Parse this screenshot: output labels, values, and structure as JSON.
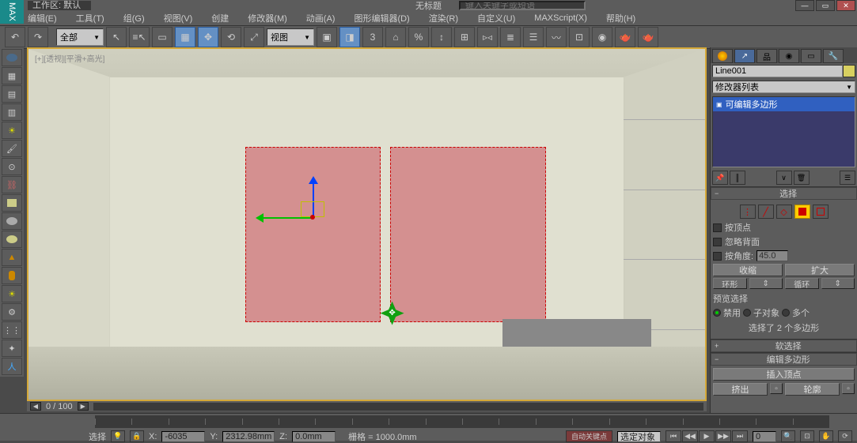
{
  "app": {
    "name": "MAX",
    "workspace_label": "工作区: 默认",
    "doc_title": "无标题",
    "search_placeholder": "键入关键字或短语"
  },
  "menus": [
    "编辑(E)",
    "工具(T)",
    "组(G)",
    "视图(V)",
    "创建",
    "修改器(M)",
    "动画(A)",
    "图形编辑器(D)",
    "渲染(R)",
    "自定义(U)",
    "MAXScript(X)",
    "帮助(H)"
  ],
  "toolbar": {
    "selection_filter": "全部",
    "refcoord": "视图"
  },
  "viewport": {
    "label": "[+][透视][平滑+高光]",
    "mini_axes": [
      "x",
      "y",
      "z"
    ],
    "scroll_label": "0 / 100"
  },
  "cmd": {
    "object_name": "Line001",
    "modlist_label": "修改器列表",
    "modifier": "可编辑多边形",
    "rollouts": {
      "selection": {
        "title": "选择",
        "by_vertex": "按顶点",
        "ignore_backfacing": "忽略背面",
        "by_angle": "按角度:",
        "angle_value": "45.0",
        "shrink": "收缩",
        "grow": "扩大",
        "ring": "环形",
        "loop": "循环",
        "preview_label": "预览选择",
        "preview_off": "禁用",
        "preview_subobj": "子对象",
        "preview_multi": "多个",
        "status": "选择了 2 个多边形"
      },
      "soft": {
        "title": "软选择"
      },
      "edit_poly": {
        "title": "编辑多边形",
        "insert_vertex": "插入顶点",
        "extrude": "挤出",
        "outline": "轮廓"
      }
    }
  },
  "status": {
    "select_label": "选择",
    "x_label": "X:",
    "x_val": "-6035",
    "y_label": "Y:",
    "y_val": "2312.98mm",
    "z_label": "Z:",
    "z_val": "0.0mm",
    "grid_label": "栅格 = 1000.0mm",
    "autokey_label": "自动关键点",
    "selected_label": "选定对象",
    "frame": "0"
  }
}
